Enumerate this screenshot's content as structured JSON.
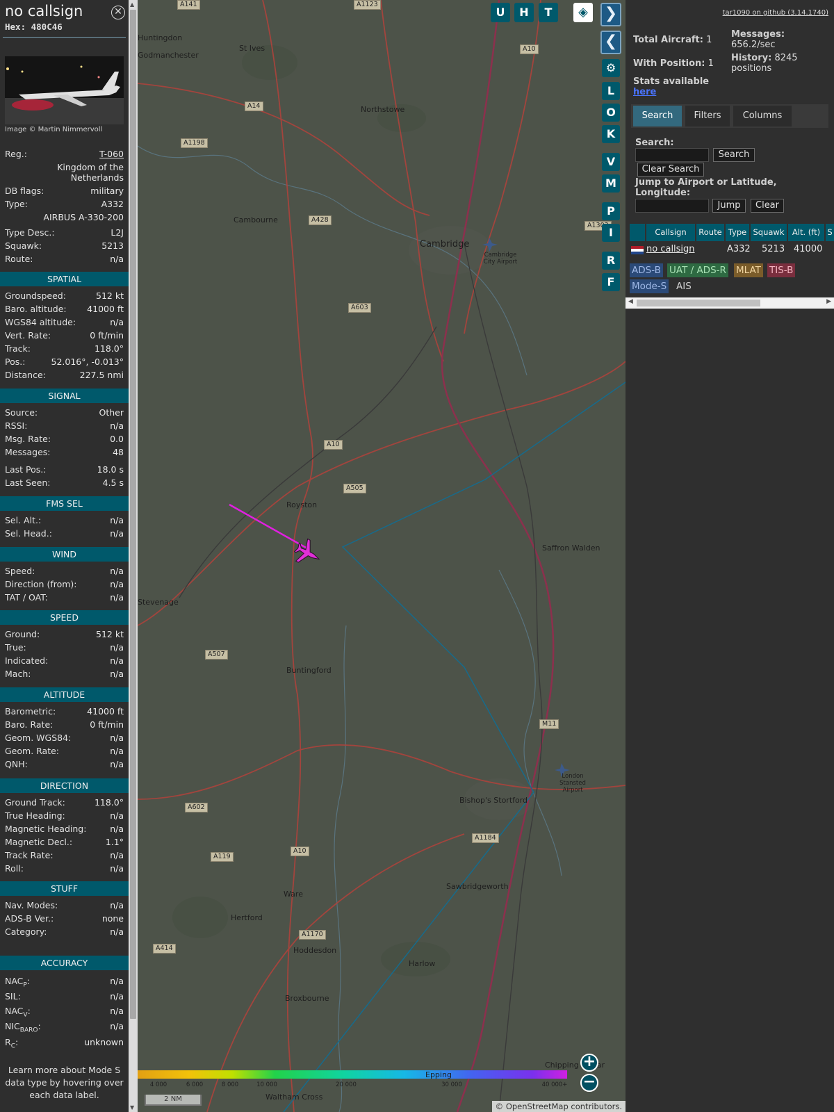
{
  "info": {
    "callsign": "no callsign",
    "hex": "Hex: 480C46",
    "image_credit": "Image © Martin Nimmervoll",
    "reg_label": "Reg.:",
    "reg_value": "T-060",
    "country": "Kingdom of the Netherlands",
    "dbflags_label": "DB flags:",
    "dbflags_value": "military",
    "type_label": "Type:",
    "type_value": "A332",
    "type_name": "AIRBUS A-330-200",
    "typedesc_label": "Type Desc.:",
    "typedesc_value": "L2J",
    "squawk_label": "Squawk:",
    "squawk_value": "5213",
    "route_label": "Route:",
    "route_value": "n/a",
    "sections": {
      "spatial": "SPATIAL",
      "signal": "SIGNAL",
      "fmssel": "FMS SEL",
      "wind": "WIND",
      "speed": "SPEED",
      "altitude": "ALTITUDE",
      "direction": "DIRECTION",
      "stuff": "STUFF",
      "accuracy": "ACCURACY"
    },
    "spatial": [
      {
        "label": "Groundspeed:",
        "value": "512 kt"
      },
      {
        "label": "Baro. altitude:",
        "value": "41000 ft"
      },
      {
        "label": "WGS84 altitude:",
        "value": "n/a"
      },
      {
        "label": "Vert. Rate:",
        "value": "0 ft/min"
      },
      {
        "label": "Track:",
        "value": "118.0°"
      },
      {
        "label": "Pos.:",
        "value": "52.016°, -0.013°"
      },
      {
        "label": "Distance:",
        "value": "227.5 nmi"
      }
    ],
    "signal": [
      {
        "label": "Source:",
        "value": "Other"
      },
      {
        "label": "RSSI:",
        "value": "n/a"
      },
      {
        "label": "Msg. Rate:",
        "value": "0.0"
      },
      {
        "label": "Messages:",
        "value": "48"
      },
      {
        "label": "Last Pos.:",
        "value": "18.0 s"
      },
      {
        "label": "Last Seen:",
        "value": "4.5 s"
      }
    ],
    "fmssel": [
      {
        "label": "Sel. Alt.:",
        "value": "n/a"
      },
      {
        "label": "Sel. Head.:",
        "value": "n/a"
      }
    ],
    "wind": [
      {
        "label": "Speed:",
        "value": "n/a"
      },
      {
        "label": "Direction (from):",
        "value": "n/a"
      },
      {
        "label": "TAT / OAT:",
        "value": "n/a"
      }
    ],
    "speed": [
      {
        "label": "Ground:",
        "value": "512 kt"
      },
      {
        "label": "True:",
        "value": "n/a"
      },
      {
        "label": "Indicated:",
        "value": "n/a"
      },
      {
        "label": "Mach:",
        "value": "n/a"
      }
    ],
    "altitude": [
      {
        "label": "Barometric:",
        "value": "41000 ft"
      },
      {
        "label": "Baro. Rate:",
        "value": "0 ft/min"
      },
      {
        "label": "Geom. WGS84:",
        "value": "n/a"
      },
      {
        "label": "Geom. Rate:",
        "value": "n/a"
      },
      {
        "label": "QNH:",
        "value": "n/a"
      }
    ],
    "direction": [
      {
        "label": "Ground Track:",
        "value": "118.0°"
      },
      {
        "label": "True Heading:",
        "value": "n/a"
      },
      {
        "label": "Magnetic Heading:",
        "value": "n/a"
      },
      {
        "label": "Magnetic Decl.:",
        "value": "1.1°"
      },
      {
        "label": "Track Rate:",
        "value": "n/a"
      },
      {
        "label": "Roll:",
        "value": "n/a"
      }
    ],
    "stuff": [
      {
        "label": "Nav. Modes:",
        "value": "n/a"
      },
      {
        "label": "ADS-B Ver.:",
        "value": "none"
      },
      {
        "label": "Category:",
        "value": "n/a"
      }
    ],
    "accuracy": [
      {
        "label": "NAC",
        "sub": "P",
        "value": "n/a"
      },
      {
        "label": "SIL:",
        "sub": "",
        "value": "n/a"
      },
      {
        "label": "NAC",
        "sub": "V",
        "value": "n/a"
      },
      {
        "label": "NIC",
        "sub": "BARO",
        "value": "n/a"
      },
      {
        "label": "R",
        "sub": "C",
        "value": "unknown"
      }
    ],
    "footer": "Learn more about Mode S data type by hovering over each data label."
  },
  "map": {
    "buttons_top": [
      "U",
      "H",
      "T"
    ],
    "buttons_side": [
      "L",
      "O",
      "K",
      "V",
      "M",
      "P",
      "I",
      "R",
      "F"
    ],
    "layers_icon": "layers-icon",
    "settings_icon": "gear-icon",
    "zoom_in": "+",
    "zoom_out": "−",
    "scale": "2 NM",
    "attribution": "© OpenStreetMap contributors.",
    "colorbar": [
      "4 000",
      "6 000",
      "8 000",
      "10 000",
      "20 000",
      "30 000",
      "40 000+"
    ],
    "places": [
      "St Ives",
      "Northstowe",
      "Cambourne",
      "Cambridge",
      "Cambridge City Airport",
      "Royston",
      "Saffron Walden",
      "Buntingford",
      "Bishop's Stortford",
      "London Stansted Airport",
      "Sawbridgeworth",
      "Ware",
      "Hertford",
      "Harlow",
      "Hoddesdon",
      "Broxbourne",
      "Waltham Cross",
      "Chipping Ongar",
      "Epping",
      "Huntingdon",
      "Godmanchester",
      "Stevenage"
    ],
    "roads": [
      "A141",
      "A1123",
      "A10",
      "A14",
      "A1198",
      "A428",
      "A1303",
      "A603",
      "A10",
      "A505",
      "A507",
      "M11",
      "A602",
      "A10",
      "A119",
      "A1184",
      "A1170",
      "A414",
      "A10"
    ]
  },
  "sidebar": {
    "github": "tar1090 on github (3.14.1740)",
    "total_aircraft_label": "Total Aircraft:",
    "total_aircraft": "1",
    "with_position_label": "With Position:",
    "with_position": "1",
    "messages_label": "Messages:",
    "messages": "656.2/sec",
    "history_label": "History:",
    "history": "8245 positions",
    "stats_label": "Stats available",
    "stats_link": "here",
    "tabs": [
      "Search",
      "Filters",
      "Columns"
    ],
    "search_label": "Search:",
    "search_button": "Search",
    "clear_search_button": "Clear Search",
    "jump_label": "Jump to Airport or Latitude, Longitude:",
    "jump_button": "Jump",
    "clear_button": "Clear",
    "table_headers": [
      "Callsign",
      "Route",
      "Type",
      "Squawk",
      "Alt. (ft)",
      "S"
    ],
    "table_row": {
      "callsign": "no callsign",
      "route": "",
      "type": "A332",
      "squawk": "5213",
      "alt": "41000",
      "flag": "NL-flag-icon"
    },
    "sources": [
      {
        "label": "ADS-B",
        "color": "#2b4a78"
      },
      {
        "label": "UAT / ADS-R",
        "color": "#2e6a42"
      },
      {
        "label": "MLAT",
        "color": "#7a5c2a"
      },
      {
        "label": "TIS-B",
        "color": "#7a2e3e"
      },
      {
        "label": "Mode-S",
        "color": "#2b4a78"
      },
      {
        "label": "AIS",
        "color": "#2f2f2f"
      }
    ]
  }
}
